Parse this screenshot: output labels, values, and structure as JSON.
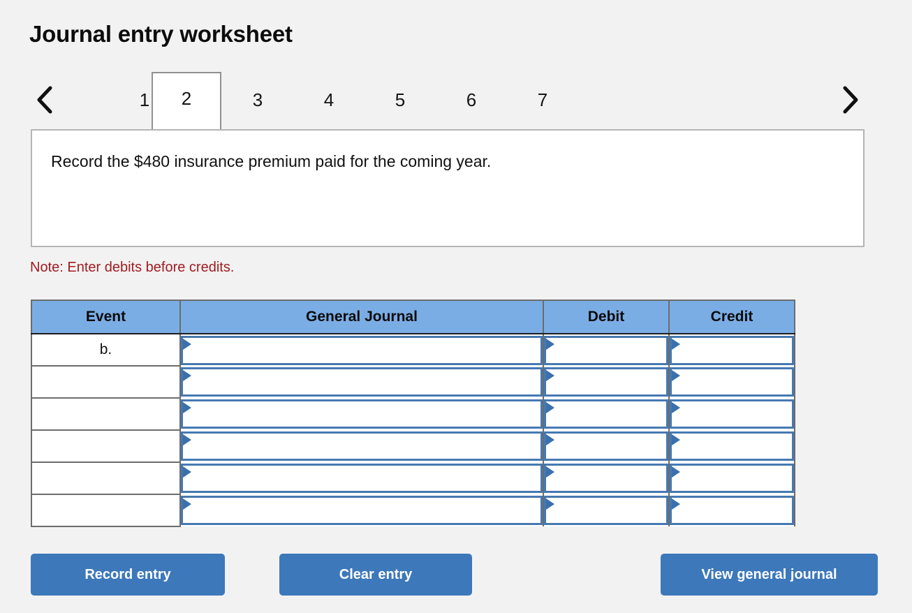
{
  "header": {
    "title": "Journal entry worksheet"
  },
  "tabs": {
    "prev_icon": "chevron-left-icon",
    "next_icon": "chevron-right-icon",
    "items": [
      {
        "label": "1",
        "active": false
      },
      {
        "label": "2",
        "active": true
      },
      {
        "label": "3",
        "active": false
      },
      {
        "label": "4",
        "active": false
      },
      {
        "label": "5",
        "active": false
      },
      {
        "label": "6",
        "active": false
      },
      {
        "label": "7",
        "active": false
      }
    ]
  },
  "instruction": {
    "text": "Record the $480 insurance premium paid for the coming year."
  },
  "note": {
    "text": "Note: Enter debits before credits."
  },
  "table": {
    "columns": [
      "Event",
      "General Journal",
      "Debit",
      "Credit"
    ],
    "rows": [
      {
        "event": "b.",
        "general_journal": "",
        "debit": "",
        "credit": ""
      },
      {
        "event": "",
        "general_journal": "",
        "debit": "",
        "credit": ""
      },
      {
        "event": "",
        "general_journal": "",
        "debit": "",
        "credit": ""
      },
      {
        "event": "",
        "general_journal": "",
        "debit": "",
        "credit": ""
      },
      {
        "event": "",
        "general_journal": "",
        "debit": "",
        "credit": ""
      },
      {
        "event": "",
        "general_journal": "",
        "debit": "",
        "credit": ""
      }
    ]
  },
  "actions": {
    "record": "Record entry",
    "clear": "Clear entry",
    "view": "View general journal"
  },
  "colors": {
    "page_background": "#f2f2f2",
    "header_blue": "#7bade5",
    "button_blue": "#3d78bb",
    "note_red": "#a01c21",
    "input_border_blue": "#4679b1",
    "grid_gray": "#6c6c6c"
  }
}
